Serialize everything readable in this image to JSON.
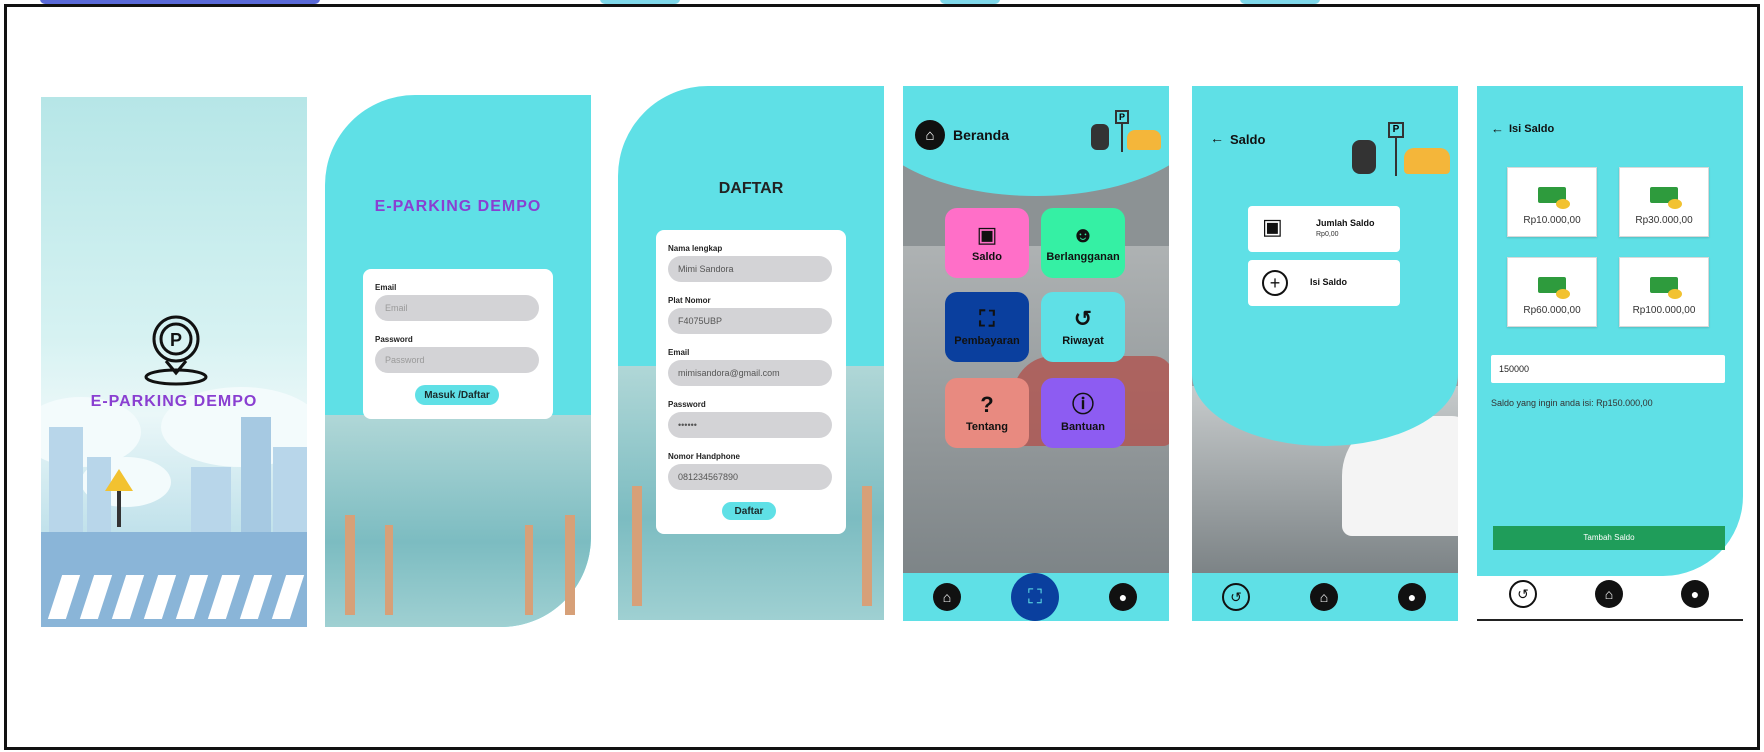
{
  "splash": {
    "brand": "E-PARKING DEMPO"
  },
  "login": {
    "title": "E-PARKING DEMPO",
    "email_label": "Email",
    "email_placeholder": "Email",
    "password_label": "Password",
    "password_placeholder": "Password",
    "submit_label": "Masuk /Daftar"
  },
  "register": {
    "title": "DAFTAR",
    "fields": [
      {
        "label": "Nama lengkap",
        "value": "Mimi Sandora"
      },
      {
        "label": "Plat Nomor",
        "value": "F4075UBP"
      },
      {
        "label": "Email",
        "value": "mimisandora@gmail.com"
      },
      {
        "label": "Password",
        "value": "••••••"
      },
      {
        "label": "Nomor Handphone",
        "value": "081234567890"
      }
    ],
    "submit_label": "Daftar"
  },
  "home": {
    "title": "Beranda",
    "tiles": [
      {
        "label": "Saldo",
        "icon": "wallet-icon",
        "color": "#ff6fc8"
      },
      {
        "label": "Berlangganan",
        "icon": "group-icon",
        "color": "#35f0a4"
      },
      {
        "label": "Pembayaran",
        "icon": "scan-icon",
        "color": "#0a3f9e"
      },
      {
        "label": "Riwayat",
        "icon": "history-icon",
        "color": "#5fe0e6"
      },
      {
        "label": "Tentang",
        "icon": "question-icon",
        "color": "#e88a80"
      },
      {
        "label": "Bantuan",
        "icon": "info-icon",
        "color": "#8d5cf2"
      }
    ]
  },
  "saldo": {
    "title": "Saldo",
    "balance_label": "Jumlah Saldo",
    "balance_value": "Rp0,00",
    "topup_label": "Isi Saldo"
  },
  "topup": {
    "title": "Isi Saldo",
    "amounts": [
      "Rp10.000,00",
      "Rp30.000,00",
      "Rp60.000,00",
      "Rp100.000,00"
    ],
    "input_value": "150000",
    "summary_prefix": "Saldo yang ingin anda isi:",
    "summary_value": "Rp150.000,00",
    "submit_label": "Tambah Saldo"
  },
  "colors": {
    "cyan": "#5fe0e6",
    "purple": "#8a3fd1",
    "green_button": "#1f9d5a"
  }
}
